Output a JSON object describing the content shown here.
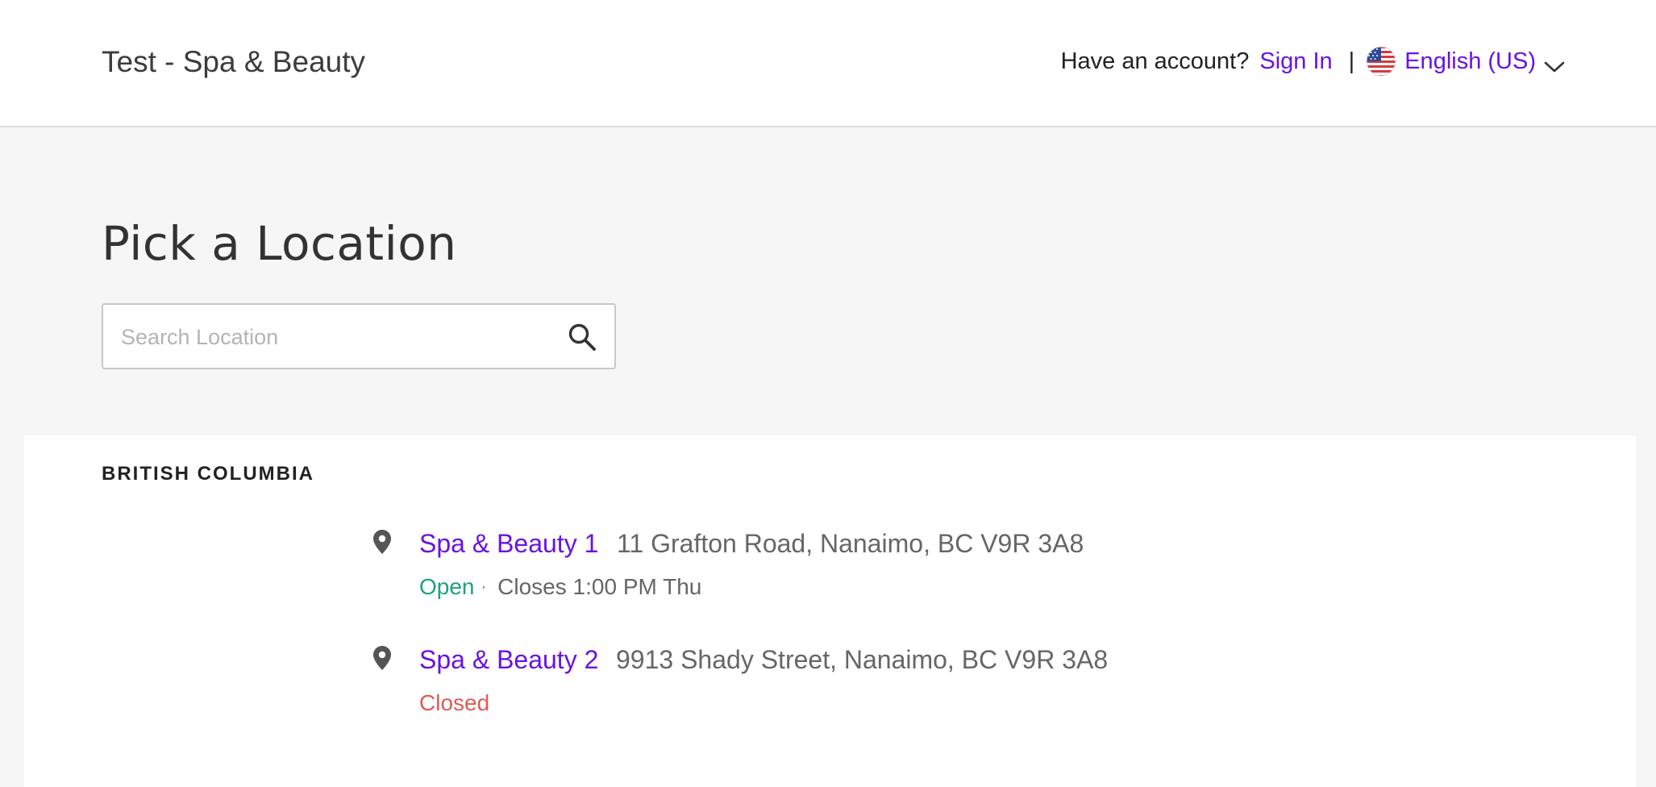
{
  "header": {
    "site_title": "Test - Spa & Beauty",
    "account_prompt": "Have an account?",
    "sign_in": "Sign In",
    "divider": "|",
    "language": "English (US)",
    "flag_icon": "us-flag-icon",
    "chevron_icon": "chevron-down-icon"
  },
  "main": {
    "title": "Pick a Location",
    "search": {
      "placeholder": "Search Location",
      "value": "",
      "icon": "search-icon"
    }
  },
  "regions": [
    {
      "name": "BRITISH COLUMBIA",
      "locations": [
        {
          "name": "Spa & Beauty 1",
          "address": "11 Grafton Road, Nanaimo, BC V9R 3A8",
          "status": "Open",
          "separator": "·",
          "closes": "Closes 1:00 PM Thu"
        },
        {
          "name": "Spa & Beauty 2",
          "address": "9913 Shady Street, Nanaimo, BC V9R 3A8",
          "status": "Closed"
        }
      ]
    }
  ],
  "colors": {
    "accent": "#6a12e3",
    "open": "#1aa37a",
    "closed": "#e05a55",
    "background": "#f6f6f6"
  }
}
